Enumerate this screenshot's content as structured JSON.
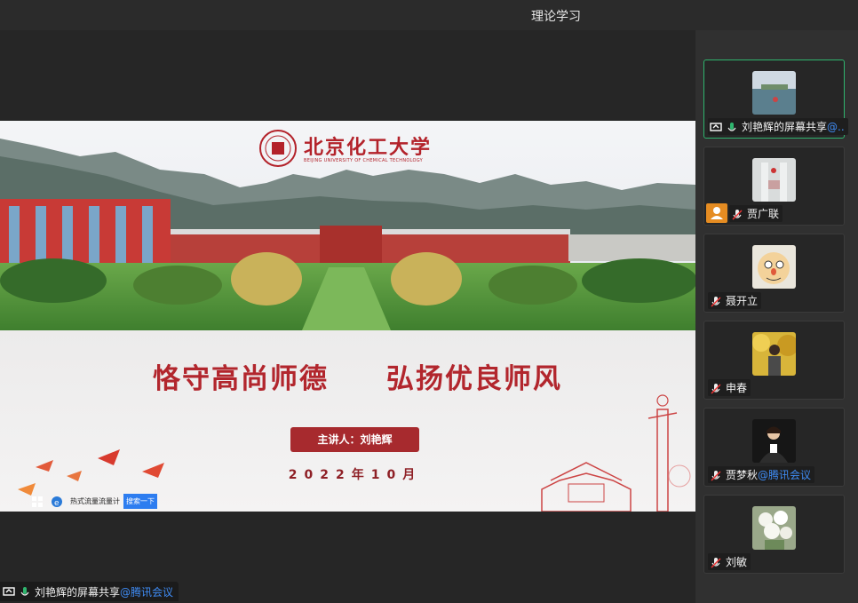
{
  "window": {
    "title": "理论学习"
  },
  "slide": {
    "university_cn": "北京化工大学",
    "university_en": "BEIJING UNIVERSITY OF CHEMICAL TECHNOLOGY",
    "slogan_left": "恪守高尚师德",
    "slogan_right": "弘扬优良师风",
    "speaker": "主讲人：刘艳辉",
    "date": "2022年10月",
    "taskbar": {
      "text": "热式流量流量计",
      "button": "搜索一下"
    }
  },
  "share_status": {
    "name": "刘艳辉的屏幕共享",
    "brand": "@腾讯会议"
  },
  "participants": [
    {
      "name": "刘艳辉的屏幕共享",
      "brand": "@..",
      "avatar": "lake-photo",
      "mic": "on",
      "screen_share": true,
      "active": true
    },
    {
      "name": "贾广联",
      "avatar": "snowy-gate-photo",
      "mic": "muted",
      "host": true
    },
    {
      "name": "聂开立",
      "avatar": "cartoon-face"
    },
    {
      "name": "申春",
      "avatar": "autumn-tree-portrait",
      "mic": "muted"
    },
    {
      "name": "贾梦秋",
      "brand": "@腾讯会议",
      "avatar": "portrait-photo",
      "mic": "muted"
    },
    {
      "name": "刘敏",
      "avatar": "white-roses-photo",
      "mic": "muted"
    }
  ],
  "colors": {
    "accent_green": "#2fb56e",
    "brand_blue": "#3f8cf5",
    "slide_red": "#b2262d",
    "host_orange": "#e58c22"
  }
}
